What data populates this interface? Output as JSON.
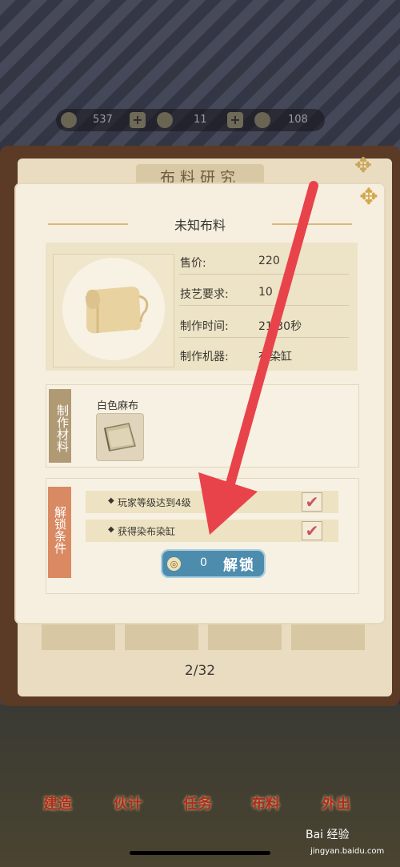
{
  "resources": {
    "coins": "537",
    "tea": "11",
    "flowers": "108"
  },
  "book": {
    "title": "布料研究",
    "page": "2/32"
  },
  "modal": {
    "fabric_name": "未知布料",
    "stats": [
      {
        "label": "售价:",
        "value": "220"
      },
      {
        "label": "技艺要求:",
        "value": "10"
      },
      {
        "label": "制作时间:",
        "value": "21 30秒"
      },
      {
        "label": "制作机器:",
        "value": "布染缸"
      }
    ],
    "materials_tag": "制作材料",
    "material_name": "白色麻布",
    "conditions_tag": "解锁条件",
    "conditions": [
      {
        "text": "玩家等级达到4级",
        "checked": true
      },
      {
        "text": "获得染布染缸",
        "checked": true
      }
    ],
    "unlock_cost": "0",
    "unlock_label": "解锁"
  },
  "bottom_nav": [
    "建造",
    "伙计",
    "任务",
    "布料",
    "外出"
  ],
  "watermark": {
    "brand": "Bai 经验",
    "url": "jingyan.baidu.com"
  },
  "colors": {
    "arrow": "#e8434b",
    "unlock_button": "#4e8cad",
    "condition_tag": "#d98a62",
    "material_tag": "#b09a74",
    "check": "#c95660"
  },
  "icons": {
    "fabric_scroll": "scroll-icon",
    "material_linen": "linen-cloth-icon",
    "coin": "coin-icon",
    "close": "close-flower-icon",
    "check": "check-icon"
  }
}
